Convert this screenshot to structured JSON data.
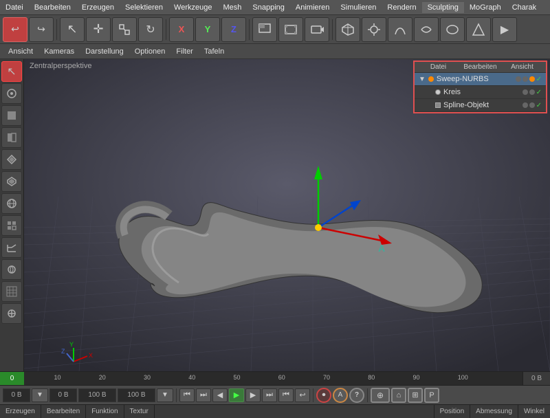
{
  "menubar": {
    "items": [
      "Datei",
      "Bearbeiten",
      "Erzeugen",
      "Selektieren",
      "Werkzeuge",
      "Mesh",
      "Snapping",
      "Animieren",
      "Simulieren",
      "Rendern",
      "Sculpting",
      "MoGraph",
      "Charak"
    ]
  },
  "toolbar": {
    "buttons": [
      {
        "id": "undo",
        "icon": "↩",
        "active": false
      },
      {
        "id": "redo",
        "icon": "↪",
        "active": false
      },
      {
        "id": "select",
        "icon": "↖",
        "active": false
      },
      {
        "id": "move",
        "icon": "✛",
        "active": false
      },
      {
        "id": "scale",
        "icon": "⊡",
        "active": false
      },
      {
        "id": "rotate",
        "icon": "↻",
        "active": false
      },
      {
        "id": "tool1",
        "icon": "✖",
        "active": false
      },
      {
        "id": "tool2",
        "icon": "◯",
        "active": false
      },
      {
        "id": "tool3",
        "icon": "↑",
        "active": false
      },
      {
        "id": "tool4",
        "icon": "⊞",
        "active": false
      },
      {
        "id": "tool5",
        "icon": "⊟",
        "active": false
      },
      {
        "id": "tool6",
        "icon": "▷",
        "active": false
      },
      {
        "id": "tool7",
        "icon": "◈",
        "active": false
      },
      {
        "id": "tool8",
        "icon": "⬡",
        "active": false
      },
      {
        "id": "tool9",
        "icon": "⬟",
        "active": false
      },
      {
        "id": "tool10",
        "icon": "◇",
        "active": false
      }
    ]
  },
  "toolbar2": {
    "items": [
      "Ansicht",
      "Kameras",
      "Darstellung",
      "Optionen",
      "Filter",
      "Tafeln"
    ]
  },
  "viewport_label": "Zentralperspektive",
  "object_panel": {
    "headers": [
      "Datei",
      "Bearbeiten",
      "Ansicht"
    ],
    "objects": [
      {
        "name": "Sweep-NURBS",
        "level": 0,
        "dot": "orange",
        "hasChildren": true
      },
      {
        "name": "Kreis",
        "level": 1,
        "dot": "white"
      },
      {
        "name": "Spline-Objekt",
        "level": 1,
        "dot": "white"
      }
    ]
  },
  "timeline": {
    "start_value": "0",
    "end_value": "0 B",
    "markers": [
      "10",
      "20",
      "30",
      "40",
      "50",
      "60",
      "70",
      "80",
      "90",
      "100"
    ]
  },
  "bottom_controls": {
    "mem1": "0 B",
    "mem2": "0 B",
    "mem3": "100 B",
    "mem4": "100 B"
  },
  "statusbar": {
    "sections": [
      {
        "label": "Erzeugen"
      },
      {
        "label": "Bearbeiten"
      },
      {
        "label": "Funktion"
      },
      {
        "label": "Textur"
      },
      {
        "label": "Position"
      },
      {
        "label": "Abmessung"
      },
      {
        "label": "Winkel"
      }
    ]
  },
  "sidebar_icons": [
    "↖",
    "◈",
    "■",
    "◐",
    "⬡",
    "◆",
    "◉",
    "◩",
    "∠",
    "⊙",
    "▦",
    "⊕"
  ]
}
